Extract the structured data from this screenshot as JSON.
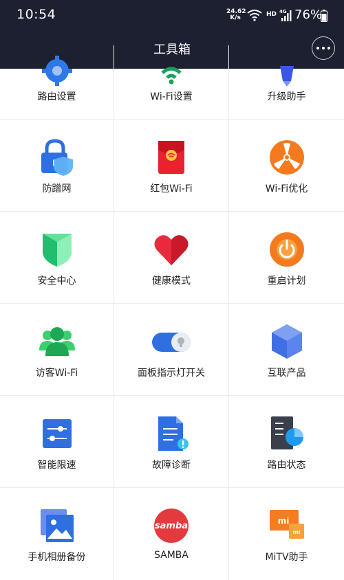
{
  "status_bar": {
    "time": "10:54",
    "net_speed": "24.62",
    "net_unit": "K/s",
    "hd": "HD",
    "network": "4G",
    "battery": "76%"
  },
  "header": {
    "title": "工具箱"
  },
  "tools": [
    {
      "label": "路由设置",
      "icon": "router-settings-icon"
    },
    {
      "label": "Wi-Fi设置",
      "icon": "wifi-settings-icon"
    },
    {
      "label": "升级助手",
      "icon": "upgrade-assistant-icon"
    },
    {
      "label": "防蹭网",
      "icon": "anti-freeloader-icon"
    },
    {
      "label": "红包Wi-Fi",
      "icon": "red-envelope-wifi-icon"
    },
    {
      "label": "Wi-Fi优化",
      "icon": "wifi-optimize-icon"
    },
    {
      "label": "安全中心",
      "icon": "security-center-icon"
    },
    {
      "label": "健康模式",
      "icon": "health-mode-icon"
    },
    {
      "label": "重启计划",
      "icon": "reboot-schedule-icon"
    },
    {
      "label": "访客Wi-Fi",
      "icon": "guest-wifi-icon"
    },
    {
      "label": "面板指示灯开关",
      "icon": "panel-light-toggle-icon"
    },
    {
      "label": "互联产品",
      "icon": "connected-products-icon"
    },
    {
      "label": "智能限速",
      "icon": "smart-speed-limit-icon"
    },
    {
      "label": "故障诊断",
      "icon": "diagnostics-icon"
    },
    {
      "label": "路由状态",
      "icon": "router-status-icon"
    },
    {
      "label": "手机相册备份",
      "icon": "photo-backup-icon"
    },
    {
      "label": "SAMBA",
      "icon": "samba-icon"
    },
    {
      "label": "MiTV助手",
      "icon": "mitv-assistant-icon"
    }
  ],
  "icon_text": {
    "samba": "samba",
    "mi": "mi"
  }
}
